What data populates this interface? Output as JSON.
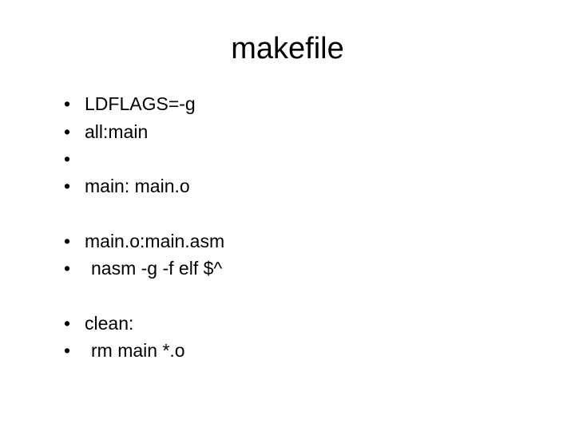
{
  "title": "makefile",
  "bullets": {
    "line1": "LDFLAGS=-g",
    "line2": "all:main",
    "line3": "",
    "line4": "main: main.o",
    "line5": "main.o:main.asm",
    "line6": "nasm -g -f elf $^",
    "line7": "clean:",
    "line8": "rm main *.o"
  }
}
